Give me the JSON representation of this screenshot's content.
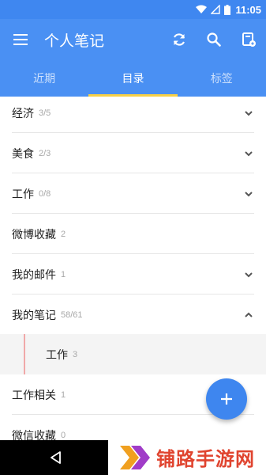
{
  "status_bar": {
    "time": "11:05",
    "icons": [
      "wifi-icon",
      "signal-icon",
      "battery-icon"
    ]
  },
  "app_bar": {
    "title": "个人笔记",
    "icons": [
      "menu-icon",
      "sync-icon",
      "search-icon",
      "notebook-settings-icon"
    ]
  },
  "tabs": [
    {
      "label": "近期",
      "active": false
    },
    {
      "label": "目录",
      "active": true
    },
    {
      "label": "标签",
      "active": false
    }
  ],
  "list": [
    {
      "name": "经济",
      "count": "3/5",
      "chevron": "down"
    },
    {
      "name": "美食",
      "count": "2/3",
      "chevron": "down"
    },
    {
      "name": "工作",
      "count": "0/8",
      "chevron": "down"
    },
    {
      "name": "微博收藏",
      "count": "2",
      "chevron": ""
    },
    {
      "name": "我的邮件",
      "count": "1",
      "chevron": "down"
    },
    {
      "name": "我的笔记",
      "count": "58/61",
      "chevron": "up"
    },
    {
      "name": "工作",
      "count": "3",
      "chevron": "",
      "child": true
    },
    {
      "name": "工作相关",
      "count": "1",
      "chevron": ""
    },
    {
      "name": "微信收藏",
      "count": "0",
      "chevron": ""
    }
  ],
  "fab": {
    "icon": "plus-icon"
  },
  "nav_bar": {
    "back_icon": "back-triangle-icon"
  },
  "watermark": {
    "text": "铺路手游网"
  },
  "colors": {
    "primary": "#4a90f3",
    "tab_indicator": "#f7d046",
    "fab": "#3e86ef",
    "watermark": "#e0442f"
  }
}
